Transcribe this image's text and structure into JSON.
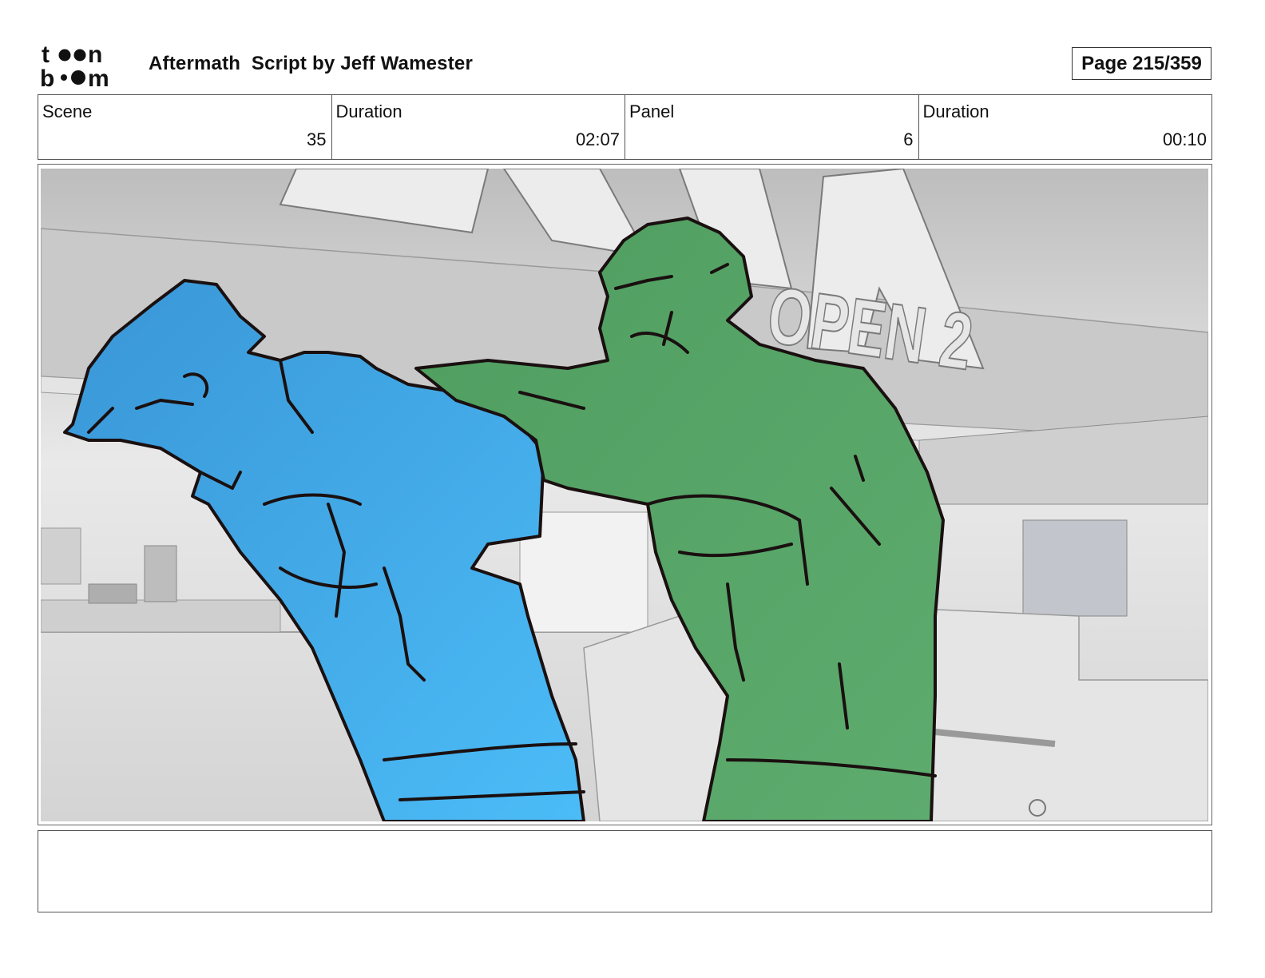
{
  "header": {
    "logo_text": "toon boom",
    "title": "Aftermath  Script by Jeff Wamester",
    "page": "Page 215/359"
  },
  "info": {
    "scene_label": "Scene",
    "scene_value": "35",
    "scene_duration_label": "Duration",
    "scene_duration_value": "02:07",
    "panel_label": "Panel",
    "panel_value": "6",
    "panel_duration_label": "Duration",
    "panel_duration_value": "00:10"
  },
  "panel": {
    "sign_text": "OPEN 2",
    "colors": {
      "blue_character": "#45B3F0",
      "green_character": "#58A86A",
      "ink": "#1a1010",
      "background": "#d8d8d8"
    }
  },
  "notes": {
    "text": ""
  }
}
